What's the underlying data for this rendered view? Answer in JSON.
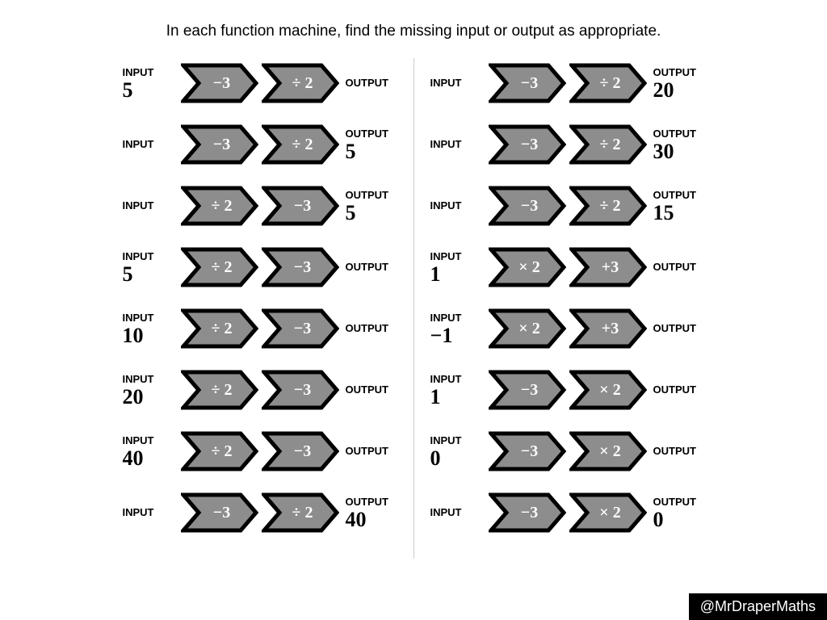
{
  "title": "In each function machine, find the missing input or output as appropriate.",
  "labels": {
    "input": "INPUT",
    "output": "OUTPUT"
  },
  "colors": {
    "arrow_fill": "#8d8d8d",
    "arrow_stroke": "#000000"
  },
  "footer": "@MrDraperMaths",
  "left": [
    {
      "input": "5",
      "ops": [
        "−3",
        "÷ 2"
      ],
      "output": ""
    },
    {
      "input": "",
      "ops": [
        "−3",
        "÷ 2"
      ],
      "output": "5"
    },
    {
      "input": "",
      "ops": [
        "÷ 2",
        "−3"
      ],
      "output": "5"
    },
    {
      "input": "5",
      "ops": [
        "÷ 2",
        "−3"
      ],
      "output": ""
    },
    {
      "input": "10",
      "ops": [
        "÷ 2",
        "−3"
      ],
      "output": ""
    },
    {
      "input": "20",
      "ops": [
        "÷ 2",
        "−3"
      ],
      "output": ""
    },
    {
      "input": "40",
      "ops": [
        "÷ 2",
        "−3"
      ],
      "output": ""
    },
    {
      "input": "",
      "ops": [
        "−3",
        "÷ 2"
      ],
      "output": "40"
    }
  ],
  "right": [
    {
      "input": "",
      "ops": [
        "−3",
        "÷ 2"
      ],
      "output": "20"
    },
    {
      "input": "",
      "ops": [
        "−3",
        "÷ 2"
      ],
      "output": "30"
    },
    {
      "input": "",
      "ops": [
        "−3",
        "÷ 2"
      ],
      "output": "15"
    },
    {
      "input": "1",
      "ops": [
        "× 2",
        "+3"
      ],
      "output": ""
    },
    {
      "input": "−1",
      "ops": [
        "× 2",
        "+3"
      ],
      "output": ""
    },
    {
      "input": "1",
      "ops": [
        "−3",
        "× 2"
      ],
      "output": ""
    },
    {
      "input": "0",
      "ops": [
        "−3",
        "× 2"
      ],
      "output": ""
    },
    {
      "input": "",
      "ops": [
        "−3",
        "× 2"
      ],
      "output": "0"
    }
  ]
}
